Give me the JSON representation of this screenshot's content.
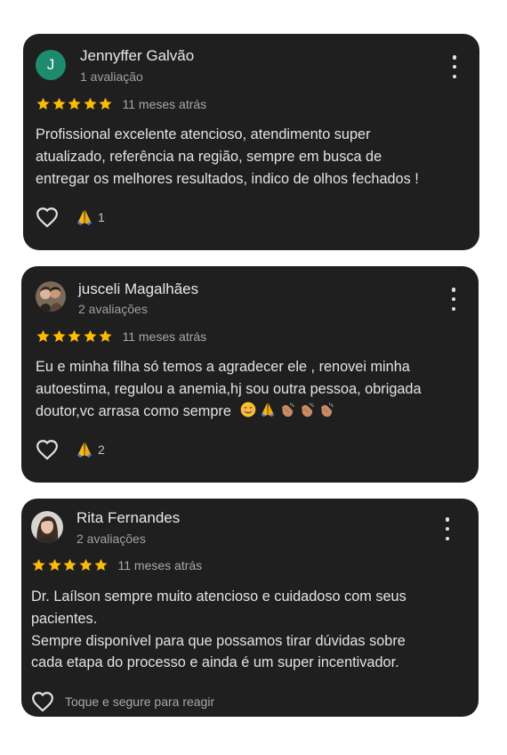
{
  "reviews": [
    {
      "author": "Jennyffer Galvão",
      "avatar_initial": "J",
      "count": "1 avaliação",
      "rating": 5,
      "time": "11 meses atrás",
      "text_lines": [
        "Profissional excelente atencioso, atendimento super",
        "atualizado, referência na região, sempre em busca de",
        "entregar os melhores resultados, indico de olhos fechados !"
      ],
      "reaction_icon": "folded-hands-emoji",
      "reaction_count": "1"
    },
    {
      "author": "jusceli Magalhães",
      "count": "2 avaliações",
      "rating": 5,
      "time": "11 meses atrás",
      "text_lines": [
        "Eu e minha filha só temos a agradecer ele , renovei minha",
        "autoestima, regulou a anemia,hj sou outra pessoa, obrigada",
        "doutor,vc arrasa como sempre"
      ],
      "trailing_emojis": [
        "smiling-face-emoji",
        "folded-hands-emoji",
        "clapping-hands-emoji",
        "clapping-hands-emoji",
        "clapping-hands-emoji"
      ],
      "reaction_icon": "folded-hands-emoji",
      "reaction_count": "2"
    },
    {
      "author": "Rita Fernandes",
      "count": "2 avaliações",
      "rating": 5,
      "time": "11 meses atrás",
      "text_lines": [
        "Dr. Laílson sempre muito atencioso e cuidadoso com seus",
        "pacientes.",
        "Sempre disponível para que possamos tirar dúvidas sobre",
        "cada etapa do processo e ainda é um super incentivador."
      ],
      "react_hint": "Toque e segure para reagir"
    }
  ],
  "colors": {
    "card_bg": "#1f1f1f",
    "star": "#fbbc04",
    "avatar_initial_bg": "#1e8a6e"
  }
}
